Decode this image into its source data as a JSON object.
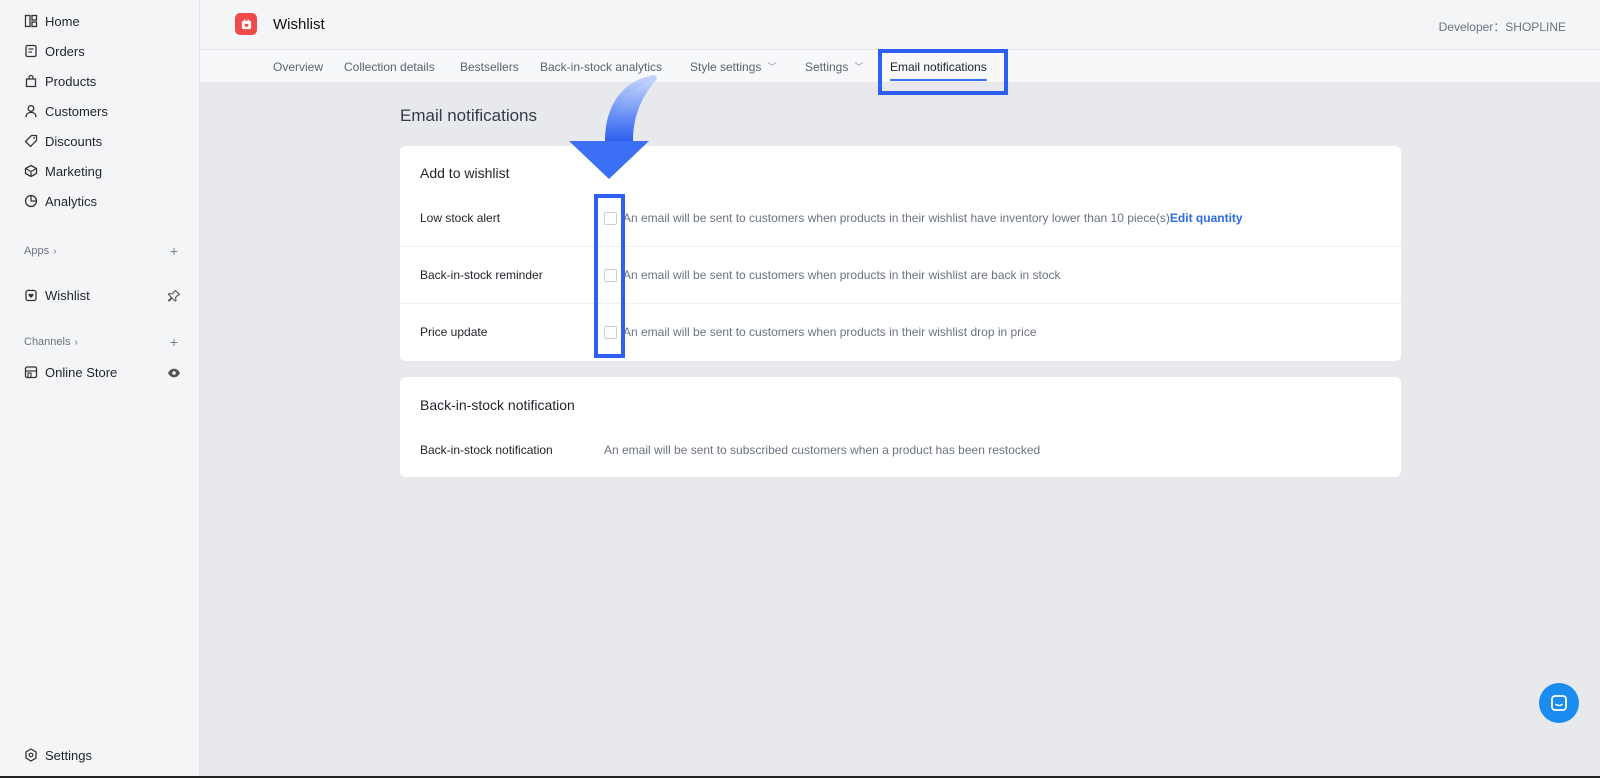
{
  "sidebar": {
    "items": [
      {
        "label": "Home",
        "icon": "home-icon"
      },
      {
        "label": "Orders",
        "icon": "orders-icon"
      },
      {
        "label": "Products",
        "icon": "products-icon"
      },
      {
        "label": "Customers",
        "icon": "customers-icon"
      },
      {
        "label": "Discounts",
        "icon": "discount-tag-icon"
      },
      {
        "label": "Marketing",
        "icon": "marketing-icon"
      },
      {
        "label": "Analytics",
        "icon": "analytics-icon"
      }
    ],
    "apps_label": "Apps",
    "apps": [
      {
        "label": "Wishlist",
        "icon": "wishlist-app-icon"
      }
    ],
    "channels_label": "Channels",
    "channels": [
      {
        "label": "Online Store",
        "icon": "store-icon"
      }
    ],
    "settings_label": "Settings"
  },
  "header": {
    "app_title": "Wishlist",
    "developer": "Developer：SHOPLINE"
  },
  "tabs": [
    {
      "label": "Overview"
    },
    {
      "label": "Collection details"
    },
    {
      "label": "Bestsellers"
    },
    {
      "label": "Back-in-stock analytics"
    },
    {
      "label": "Style settings",
      "dropdown": true
    },
    {
      "label": "Settings",
      "dropdown": true
    },
    {
      "label": "Email notifications",
      "active": true
    }
  ],
  "main": {
    "title": "Email notifications",
    "add_to_wishlist": {
      "title": "Add to wishlist",
      "rows": [
        {
          "label": "Low stock alert",
          "description": "An email will be sent to customers when products in their wishlist have inventory lower than 10 piece(s)",
          "link": "Edit quantity",
          "checked": false
        },
        {
          "label": "Back-in-stock reminder",
          "description": "An email will be sent to customers when products in their wishlist are back in stock",
          "checked": false
        },
        {
          "label": "Price update",
          "description": "An email will be sent to customers when products in their wishlist drop in price",
          "checked": false
        }
      ]
    },
    "back_in_stock": {
      "title": "Back-in-stock notification",
      "row_label": "Back-in-stock notification",
      "row_description": "An email will be sent to subscribed customers when a product has been restocked"
    }
  },
  "colors": {
    "accent": "#2f5ff0",
    "link": "#2d6ae8",
    "logo": "#f04b4b",
    "chat": "#1a8cf0"
  }
}
